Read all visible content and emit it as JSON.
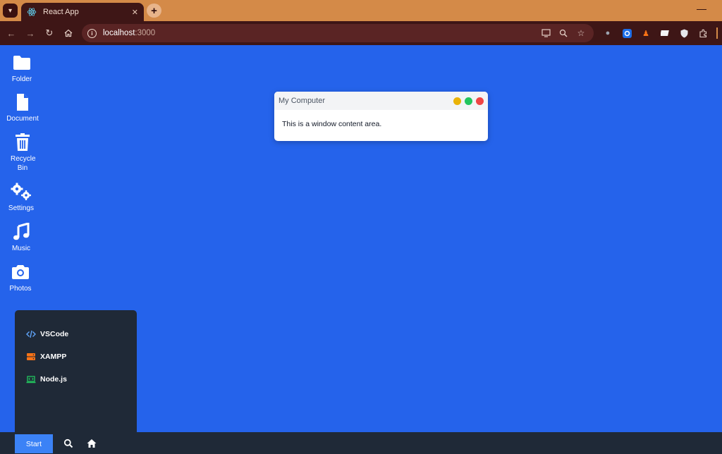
{
  "browser": {
    "tab_title": "React App",
    "tab_close": "✕",
    "new_tab": "+",
    "minimize": "—",
    "url_host": "localhost",
    "url_port": ":3000",
    "icons": [
      "tab-search-icon",
      "react-icon",
      "back-icon",
      "forward-icon",
      "reload-icon",
      "home-icon",
      "site-info-icon",
      "cast-icon",
      "zoom-icon",
      "bookmark-star-icon",
      "extension-robot-icon",
      "extension-gear-icon",
      "extension-figure-icon",
      "extension-card-icon",
      "extension-shield-icon",
      "extensions-puzzle-icon"
    ]
  },
  "desktop": {
    "background_color": "#2563eb",
    "icons": [
      {
        "label": "Folder",
        "icon": "folder-icon"
      },
      {
        "label": "Document",
        "icon": "document-icon"
      },
      {
        "label": "Recycle Bin",
        "icon": "trash-icon"
      },
      {
        "label": "Settings",
        "icon": "gears-icon"
      },
      {
        "label": "Music",
        "icon": "music-icon"
      },
      {
        "label": "Photos",
        "icon": "camera-icon"
      }
    ]
  },
  "window": {
    "title": "My Computer",
    "content": "This is a window content area.",
    "buttons": [
      {
        "name": "minimize",
        "color": "#eab308"
      },
      {
        "name": "maximize",
        "color": "#22c55e"
      },
      {
        "name": "close",
        "color": "#ef4444"
      }
    ]
  },
  "start_menu": {
    "items": [
      {
        "label": "VSCode",
        "icon": "code-icon",
        "color": "#60a5fa"
      },
      {
        "label": "XAMPP",
        "icon": "server-icon",
        "color": "#f97316"
      },
      {
        "label": "Node.js",
        "icon": "laptop-code-icon",
        "color": "#22c55e"
      }
    ]
  },
  "taskbar": {
    "start_label": "Start",
    "start_color": "#3b82f6",
    "icons": [
      "search-icon",
      "home-icon"
    ]
  }
}
